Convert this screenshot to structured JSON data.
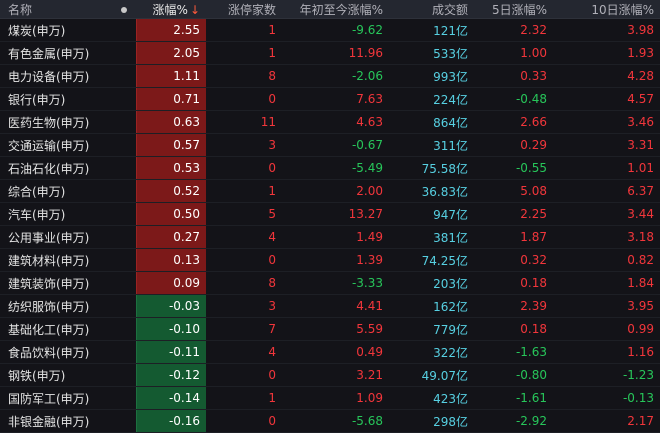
{
  "header": {
    "name": "名称",
    "change": "涨幅%",
    "sort_arrow": "↓",
    "limit_up": "涨停家数",
    "ytd": "年初至今涨幅%",
    "volume": "成交额",
    "d5": "5日涨幅%",
    "d10": "10日涨幅%"
  },
  "colors": {
    "up": "#f2363b",
    "down": "#27c65a",
    "volume": "#57d0e2",
    "up_bg": "#7c1919",
    "down_bg": "#145a31"
  },
  "rows": [
    {
      "name": "煤炭(申万)",
      "change": "2.55",
      "limit_up": "1",
      "ytd": "-9.62",
      "volume": "121亿",
      "d5": "2.32",
      "d10": "3.98"
    },
    {
      "name": "有色金属(申万)",
      "change": "2.05",
      "limit_up": "1",
      "ytd": "11.96",
      "volume": "533亿",
      "d5": "1.00",
      "d10": "1.93"
    },
    {
      "name": "电力设备(申万)",
      "change": "1.11",
      "limit_up": "8",
      "ytd": "-2.06",
      "volume": "993亿",
      "d5": "0.33",
      "d10": "4.28"
    },
    {
      "name": "银行(申万)",
      "change": "0.71",
      "limit_up": "0",
      "ytd": "7.63",
      "volume": "224亿",
      "d5": "-0.48",
      "d10": "4.57"
    },
    {
      "name": "医药生物(申万)",
      "change": "0.63",
      "limit_up": "11",
      "ytd": "4.63",
      "volume": "864亿",
      "d5": "2.66",
      "d10": "3.46"
    },
    {
      "name": "交通运输(申万)",
      "change": "0.57",
      "limit_up": "3",
      "ytd": "-0.67",
      "volume": "311亿",
      "d5": "0.29",
      "d10": "3.31"
    },
    {
      "name": "石油石化(申万)",
      "change": "0.53",
      "limit_up": "0",
      "ytd": "-5.49",
      "volume": "75.58亿",
      "d5": "-0.55",
      "d10": "1.01"
    },
    {
      "name": "综合(申万)",
      "change": "0.52",
      "limit_up": "1",
      "ytd": "2.00",
      "volume": "36.83亿",
      "d5": "5.08",
      "d10": "6.37"
    },
    {
      "name": "汽车(申万)",
      "change": "0.50",
      "limit_up": "5",
      "ytd": "13.27",
      "volume": "947亿",
      "d5": "2.25",
      "d10": "3.44"
    },
    {
      "name": "公用事业(申万)",
      "change": "0.27",
      "limit_up": "4",
      "ytd": "1.49",
      "volume": "381亿",
      "d5": "1.87",
      "d10": "3.18"
    },
    {
      "name": "建筑材料(申万)",
      "change": "0.13",
      "limit_up": "0",
      "ytd": "1.39",
      "volume": "74.25亿",
      "d5": "0.32",
      "d10": "0.82"
    },
    {
      "name": "建筑装饰(申万)",
      "change": "0.09",
      "limit_up": "8",
      "ytd": "-3.33",
      "volume": "203亿",
      "d5": "0.18",
      "d10": "1.84"
    },
    {
      "name": "纺织服饰(申万)",
      "change": "-0.03",
      "limit_up": "3",
      "ytd": "4.41",
      "volume": "162亿",
      "d5": "2.39",
      "d10": "3.95"
    },
    {
      "name": "基础化工(申万)",
      "change": "-0.10",
      "limit_up": "7",
      "ytd": "5.59",
      "volume": "779亿",
      "d5": "0.18",
      "d10": "0.99"
    },
    {
      "name": "食品饮料(申万)",
      "change": "-0.11",
      "limit_up": "4",
      "ytd": "0.49",
      "volume": "322亿",
      "d5": "-1.63",
      "d10": "1.16"
    },
    {
      "name": "钢铁(申万)",
      "change": "-0.12",
      "limit_up": "0",
      "ytd": "3.21",
      "volume": "49.07亿",
      "d5": "-0.80",
      "d10": "-1.23"
    },
    {
      "name": "国防军工(申万)",
      "change": "-0.14",
      "limit_up": "1",
      "ytd": "1.09",
      "volume": "423亿",
      "d5": "-1.61",
      "d10": "-0.13"
    },
    {
      "name": "非银金融(申万)",
      "change": "-0.16",
      "limit_up": "0",
      "ytd": "-5.68",
      "volume": "298亿",
      "d5": "-2.92",
      "d10": "2.17"
    }
  ]
}
